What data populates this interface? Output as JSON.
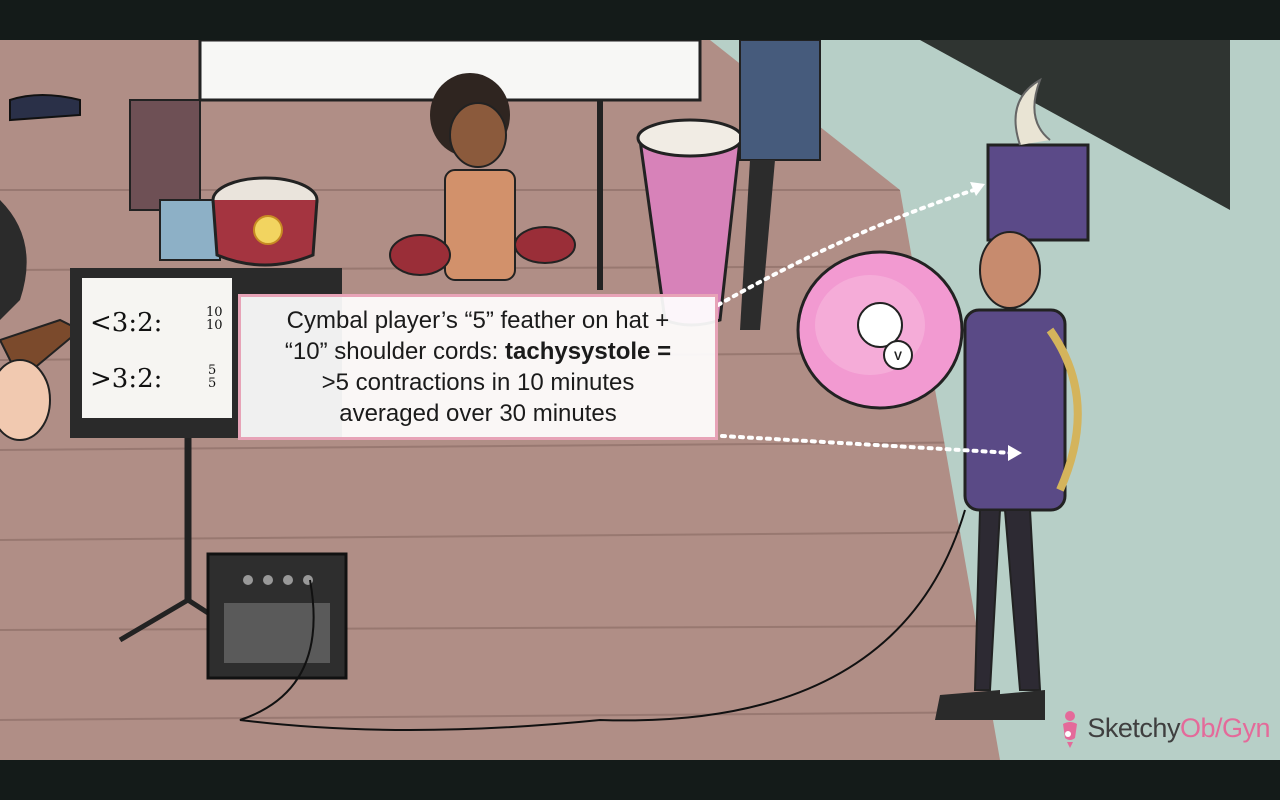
{
  "callout": {
    "line1": "Cymbal player’s “5” feather on hat +",
    "line2_prefix": "“10” shoulder cords: ",
    "line2_bold": "tachysystole =",
    "line3": ">5 contractions in 10 minutes",
    "line4": "averaged over 30 minutes"
  },
  "sheet_music": {
    "row1_left": "<3:2:",
    "row1_time_top": "10",
    "row1_time_bottom": "10",
    "row2_left": ">3:2:",
    "row2_time_top": "5",
    "row2_time_bottom": "5"
  },
  "watch_letter": "V",
  "logo": {
    "part1": "Sketchy",
    "part2": "Ob/Gyn"
  },
  "colors": {
    "accent": "#e46a9a",
    "callout_border": "#e7a3b7",
    "letterbox": "#141b19",
    "uniform": "#5a4a86",
    "floor": "#b08e86",
    "wall": "#b7cfc7"
  },
  "icons": [
    "logo-icon",
    "arrow-icon",
    "cymbal-icon",
    "drum-icon",
    "amplifier-icon",
    "music-stand-icon"
  ]
}
